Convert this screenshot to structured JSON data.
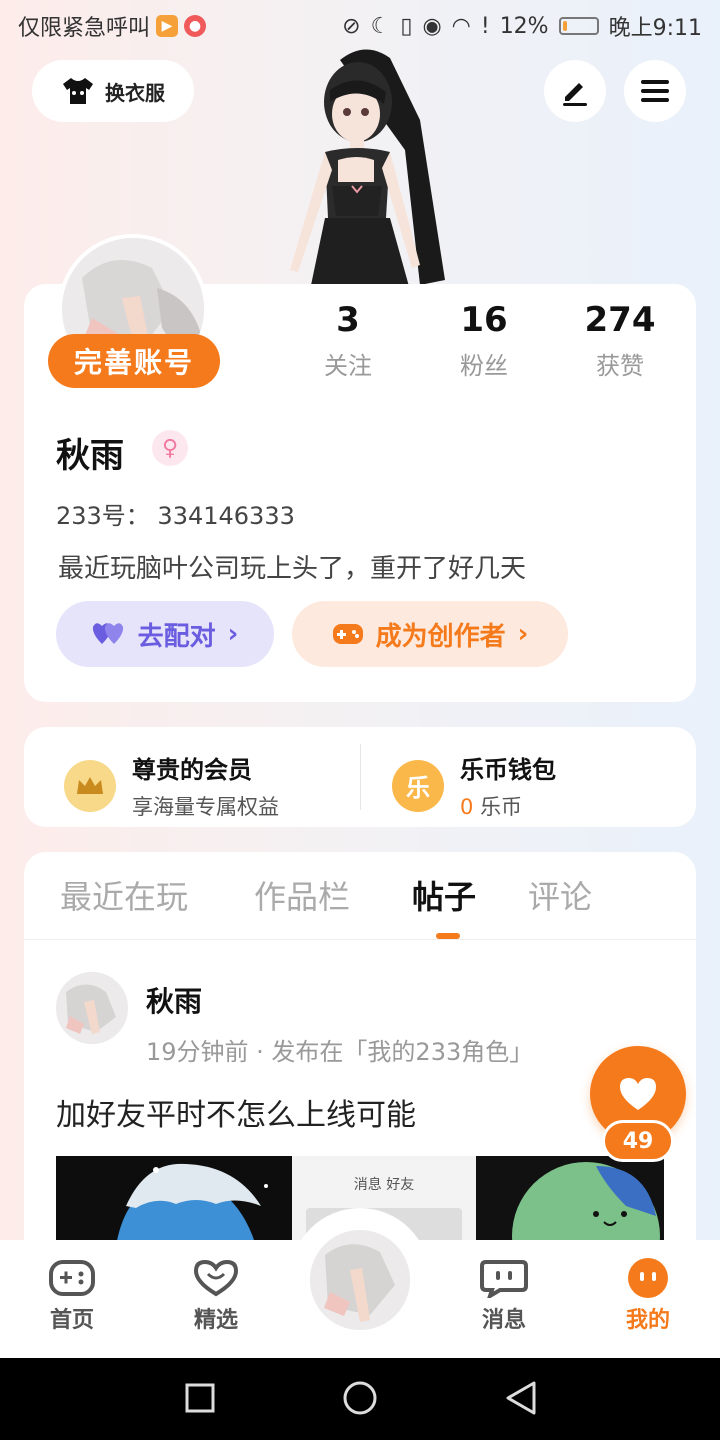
{
  "status_bar": {
    "left_text": "仅限紧急呼叫",
    "battery": "12%",
    "battery_level": 0.12,
    "time": "晚上9:11"
  },
  "top": {
    "outfit_label": "换衣服"
  },
  "profile": {
    "complete_label": "完善账号",
    "stats": [
      {
        "value": "3",
        "label": "关注"
      },
      {
        "value": "16",
        "label": "粉丝"
      },
      {
        "value": "274",
        "label": "获赞"
      }
    ],
    "name": "秋雨",
    "gender_symbol": "♀",
    "uid": "233号： 334146333",
    "bio": "最近玩脑叶公司玩上头了，重开了好几天",
    "match_label": "去配对",
    "creator_label": "成为创作者"
  },
  "membership": {
    "vip_title": "尊贵的会员",
    "vip_sub": "享海量专属权益",
    "wallet_icon_text": "乐",
    "wallet_title": "乐币钱包",
    "wallet_amount": "0",
    "wallet_unit": "乐币"
  },
  "tabs": [
    "最近在玩",
    "作品栏",
    "帖子",
    "评论"
  ],
  "active_tab": "帖子",
  "post": {
    "author": "秋雨",
    "meta": "19分钟前 · 发布在「我的233角色」",
    "text": "加好友平时不怎么上线可能",
    "like_count": "49",
    "thumb_header": "消息  好友"
  },
  "bottom_nav": [
    {
      "label": "首页",
      "icon": "gamepad-icon"
    },
    {
      "label": "精选",
      "icon": "heart-chat-icon"
    },
    {
      "label": "消息",
      "icon": "message-icon"
    },
    {
      "label": "我的",
      "icon": "profile-dots-icon"
    }
  ],
  "colors": {
    "accent": "#f57a1c",
    "match": "#6a5de0"
  }
}
